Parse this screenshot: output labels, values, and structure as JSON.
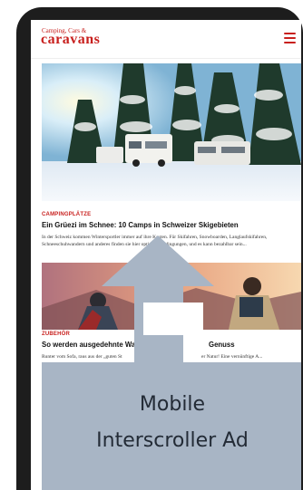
{
  "header": {
    "logo_line1": "Camping, Cars &",
    "logo_line2": "caravans"
  },
  "article1": {
    "category": "CAMPINGPLÄTZE",
    "title": "Ein Grüezi im Schnee: 10 Camps in Schweizer Skigebieten",
    "teaser": "In der Schweiz kommen Wintersportler immer auf ihre Kosten. Für Skifahren, Snowboarden, Langlaufskifahren, Schneeschuhwandern und anderes finden sie hier optimale Bedingungen, und es kann bezahlbar sein..."
  },
  "article2": {
    "category": "ZUBEHÖR",
    "title_left": "So werden ausgedehnte Wa",
    "title_right": "Genuss",
    "teaser_left": "Runter vom Sofa, raus aus der „guten St",
    "teaser_right": "er Natur! Eine vernünftige A..."
  },
  "ad": {
    "line1": "Mobile",
    "line2": "Interscroller Ad",
    "color": "#a8b5c5"
  }
}
